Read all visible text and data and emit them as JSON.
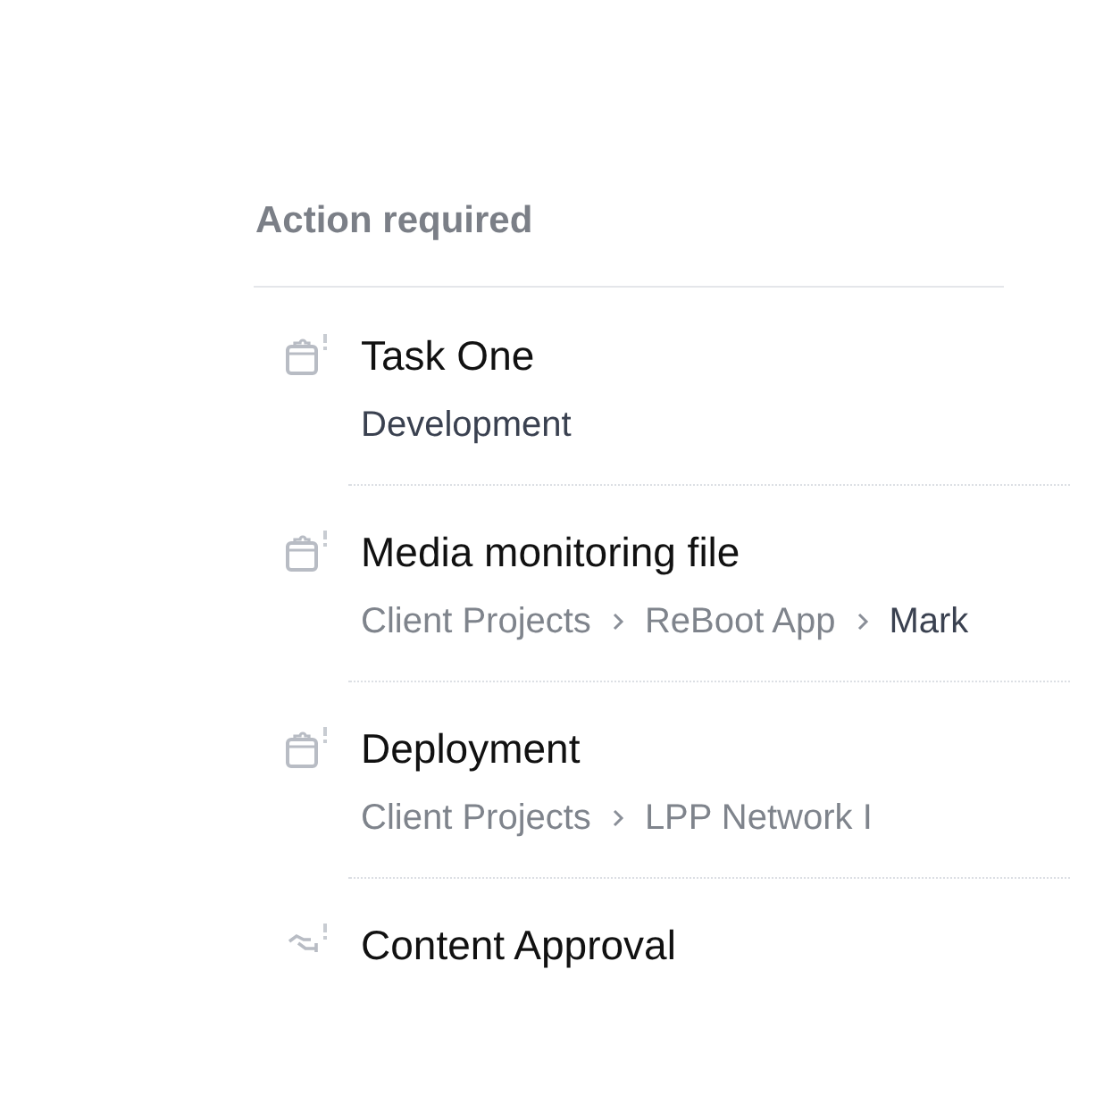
{
  "section": {
    "title": "Action required"
  },
  "items": [
    {
      "kind": "task",
      "title": "Task One",
      "path": [
        {
          "text": "Development",
          "current": true
        }
      ]
    },
    {
      "kind": "task",
      "title": "Media monitoring file",
      "path": [
        {
          "text": "Client Projects",
          "current": false
        },
        {
          "text": "ReBoot App",
          "current": false
        },
        {
          "text": "Mark",
          "current": true
        }
      ]
    },
    {
      "kind": "task",
      "title": "Deployment",
      "path": [
        {
          "text": "Client Projects",
          "current": false
        },
        {
          "text": "LPP Network I",
          "current": false
        }
      ]
    },
    {
      "kind": "approval",
      "title": "Content Approval"
    }
  ]
}
